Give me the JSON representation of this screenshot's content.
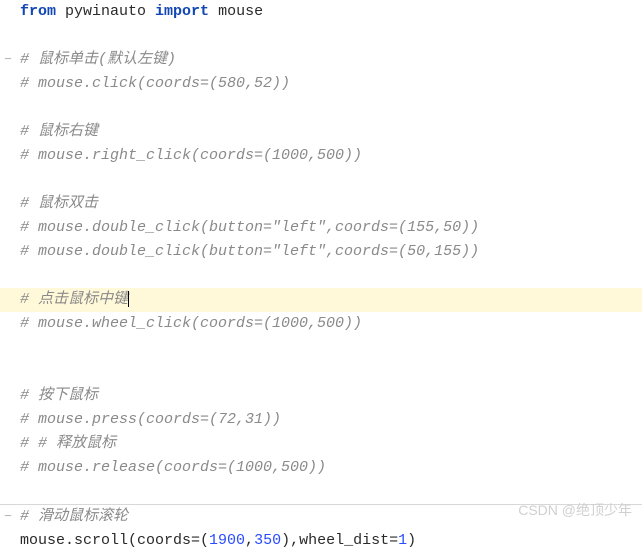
{
  "code": {
    "l1_from": "from",
    "l1_pkg": " pywinauto ",
    "l1_import": "import",
    "l1_mod": " mouse",
    "l3": "# 鼠标单击(默认左键)",
    "l4": "# mouse.click(coords=(580,52))",
    "l6": "# 鼠标右键",
    "l7": "# mouse.right_click(coords=(1000,500))",
    "l9": "# 鼠标双击",
    "l10": "# mouse.double_click(button=\"left\",coords=(155,50))",
    "l11": "# mouse.double_click(button=\"left\",coords=(50,155))",
    "l13": "# 点击鼠标中键",
    "l14": "# mouse.wheel_click(coords=(1000,500))",
    "l17": "# 按下鼠标",
    "l18": "# mouse.press(coords=(72,31))",
    "l19": "# # 释放鼠标",
    "l20": "# mouse.release(coords=(1000,500))",
    "l23": "# 滑动鼠标滚轮",
    "l24a": "mouse.scroll(coords=(",
    "l24n1": "1900",
    "l24c": ",",
    "l24n2": "350",
    "l24b": "),wheel_dist=",
    "l24n3": "1",
    "l24e": ")"
  },
  "watermark": "CSDN @绝顶少年"
}
